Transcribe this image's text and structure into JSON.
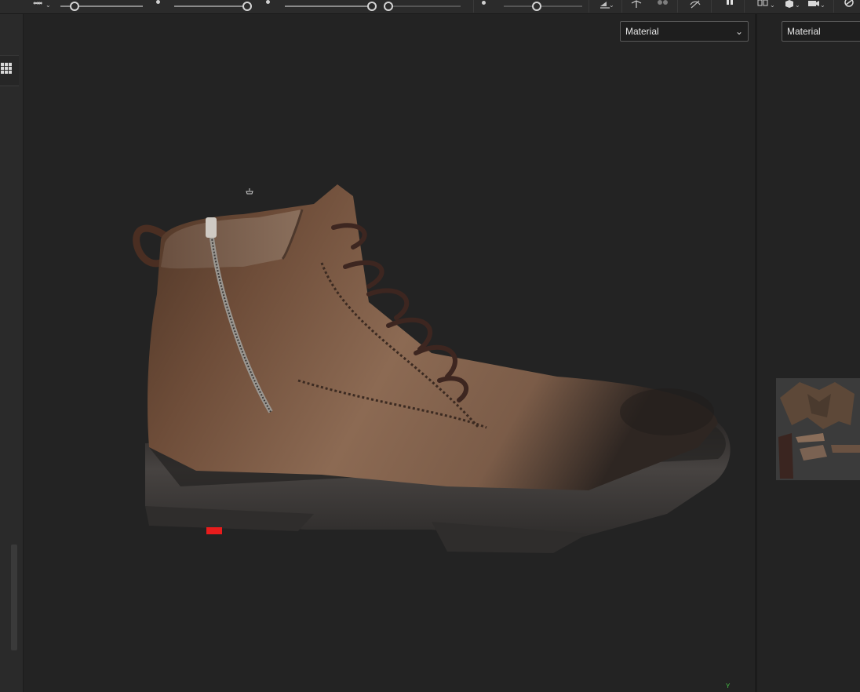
{
  "toolbar": {
    "sliders": [
      {
        "name": "slider-1",
        "value": 0.15
      },
      {
        "name": "slider-2",
        "value": 1.0
      },
      {
        "name": "slider-3",
        "value": 1.0
      },
      {
        "name": "slider-4",
        "value": 0.0
      },
      {
        "name": "slider-5",
        "value": 0.4
      }
    ],
    "icons": [
      "infinity-icon",
      "overlay-icon",
      "sync-icon",
      "hide-icon",
      "pause-icon",
      "mirror-icon",
      "cube-icon",
      "camera-icon",
      "render-icon"
    ]
  },
  "viewport": {
    "shading_mode": "Material",
    "axis_label": "Y",
    "colors": {
      "background": "#232323",
      "leather": "#8a6650",
      "sole": "#3d3b39",
      "tag": "#e81c1c"
    }
  },
  "uv_panel": {
    "shading_mode": "Material"
  }
}
